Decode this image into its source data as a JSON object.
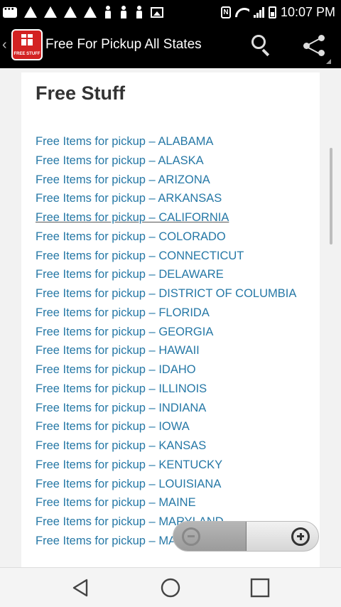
{
  "status_bar": {
    "time": "10:07 PM",
    "icons": [
      "chat-icon",
      "tree-icon",
      "tree-icon",
      "tree-icon",
      "tree-icon",
      "person-icon",
      "person-icon",
      "person-icon",
      "image-icon"
    ],
    "nfc_label": "N"
  },
  "app_bar": {
    "title": "Free For Pickup All States",
    "logo_text": "FREE STUFF"
  },
  "page": {
    "title": "Free Stuff",
    "items": [
      "Free Items for pickup  – ALABAMA",
      "Free Items for pickup  – ALASKA",
      "Free Items for pickup  – ARIZONA",
      "Free Items for pickup  – ARKANSAS",
      "Free Items for pickup  – CALIFORNIA",
      "Free Items for pickup  – COLORADO",
      "Free Items for pickup  – CONNECTICUT",
      "Free Items for pickup  – DELAWARE",
      "Free Items for pickup  – DISTRICT OF COLUMBIA",
      "Free Items for pickup  – FLORIDA",
      "Free Items for pickup  – GEORGIA",
      "Free Items for pickup  – HAWAII",
      "Free Items for pickup  – IDAHO",
      "Free Items for pickup  – ILLINOIS",
      "Free Items for pickup  – INDIANA",
      "Free Items for pickup  – IOWA",
      "Free Items for pickup  – KANSAS",
      "Free Items for pickup  – KENTUCKY",
      "Free Items for pickup  – LOUISIANA",
      "Free Items for pickup  – MAINE",
      "Free Items for pickup  – MARYLAND",
      "Free Items for pickup  – MASSACHUSETTS"
    ]
  },
  "colors": {
    "link": "#2678a6",
    "app_bar": "#000000",
    "logo": "#d32222"
  }
}
